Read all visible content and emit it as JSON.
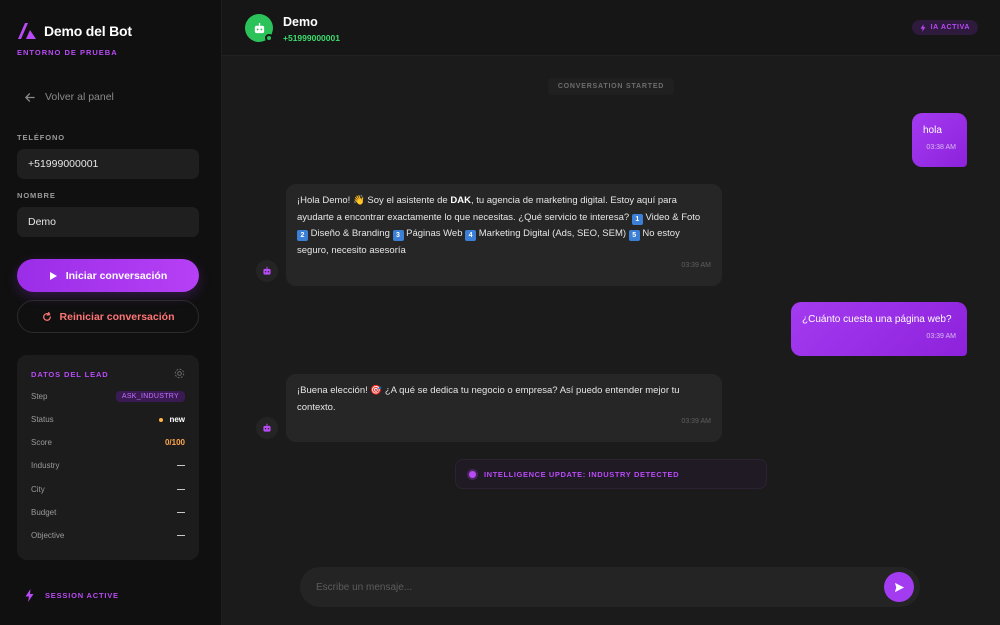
{
  "sidebar": {
    "brand_title": "Demo del Bot",
    "brand_subtitle": "ENTORNO DE PRUEBA",
    "back_label": "Volver al panel",
    "phone_label": "TELÉFONO",
    "phone_value": "+51999000001",
    "name_label": "NOMBRE",
    "name_value": "Demo",
    "start_label": "Iniciar conversación",
    "restart_label": "Reiniciar conversación",
    "lead": {
      "title": "DATOS DEL LEAD",
      "rows": [
        {
          "label": "Step",
          "value": "ASK_INDUSTRY"
        },
        {
          "label": "Status",
          "value": "new"
        },
        {
          "label": "Score",
          "value": "0/100"
        },
        {
          "label": "Industry",
          "value": "—"
        },
        {
          "label": "City",
          "value": "—"
        },
        {
          "label": "Budget",
          "value": "—"
        },
        {
          "label": "Objective",
          "value": "—"
        }
      ]
    },
    "session_label": "SESSION ACTIVE"
  },
  "header": {
    "contact_name": "Demo",
    "contact_phone": "+51999000001",
    "ia_badge": "IA ACTIVA"
  },
  "chat": {
    "conversation_started": "CONVERSATION STARTED",
    "messages": [
      {
        "from": "user",
        "text": "hola",
        "time": "03:38 AM"
      },
      {
        "from": "bot",
        "text_1": "¡Hola Demo! 👋 Soy el asistente de ",
        "text_brand": "DAK",
        "text_2": ", tu agencia de marketing digital. Estoy aquí para ayudarte a encontrar exactamente lo que necesitas. ¿Qué servicio te interesa?",
        "options": [
          "Video & Foto",
          "Diseño & Branding",
          "Páginas Web",
          "Marketing Digital (Ads, SEO, SEM)",
          "No estoy seguro, necesito asesoría"
        ],
        "time": "03:39 AM"
      },
      {
        "from": "user",
        "text": "¿Cuánto cuesta una página web?",
        "time": "03:39 AM"
      },
      {
        "from": "bot",
        "text": "¡Buena elección! 🎯 ¿A qué se dedica tu negocio o empresa? Así puedo entender mejor tu contexto.",
        "time": "03:39 AM"
      }
    ],
    "intelligence_update": "INTELLIGENCE UPDATE: INDUSTRY DETECTED"
  },
  "composer": {
    "placeholder": "Escribe un mensaje..."
  },
  "colors": {
    "accent": "#b94af7",
    "online": "#2bc25a",
    "warning": "#ffa84a",
    "danger": "#ff7676"
  },
  "icons": [
    "logo-icon",
    "arrow-left-icon",
    "play-icon",
    "refresh-icon",
    "gear-icon",
    "lightning-icon",
    "robot-icon",
    "send-icon"
  ]
}
